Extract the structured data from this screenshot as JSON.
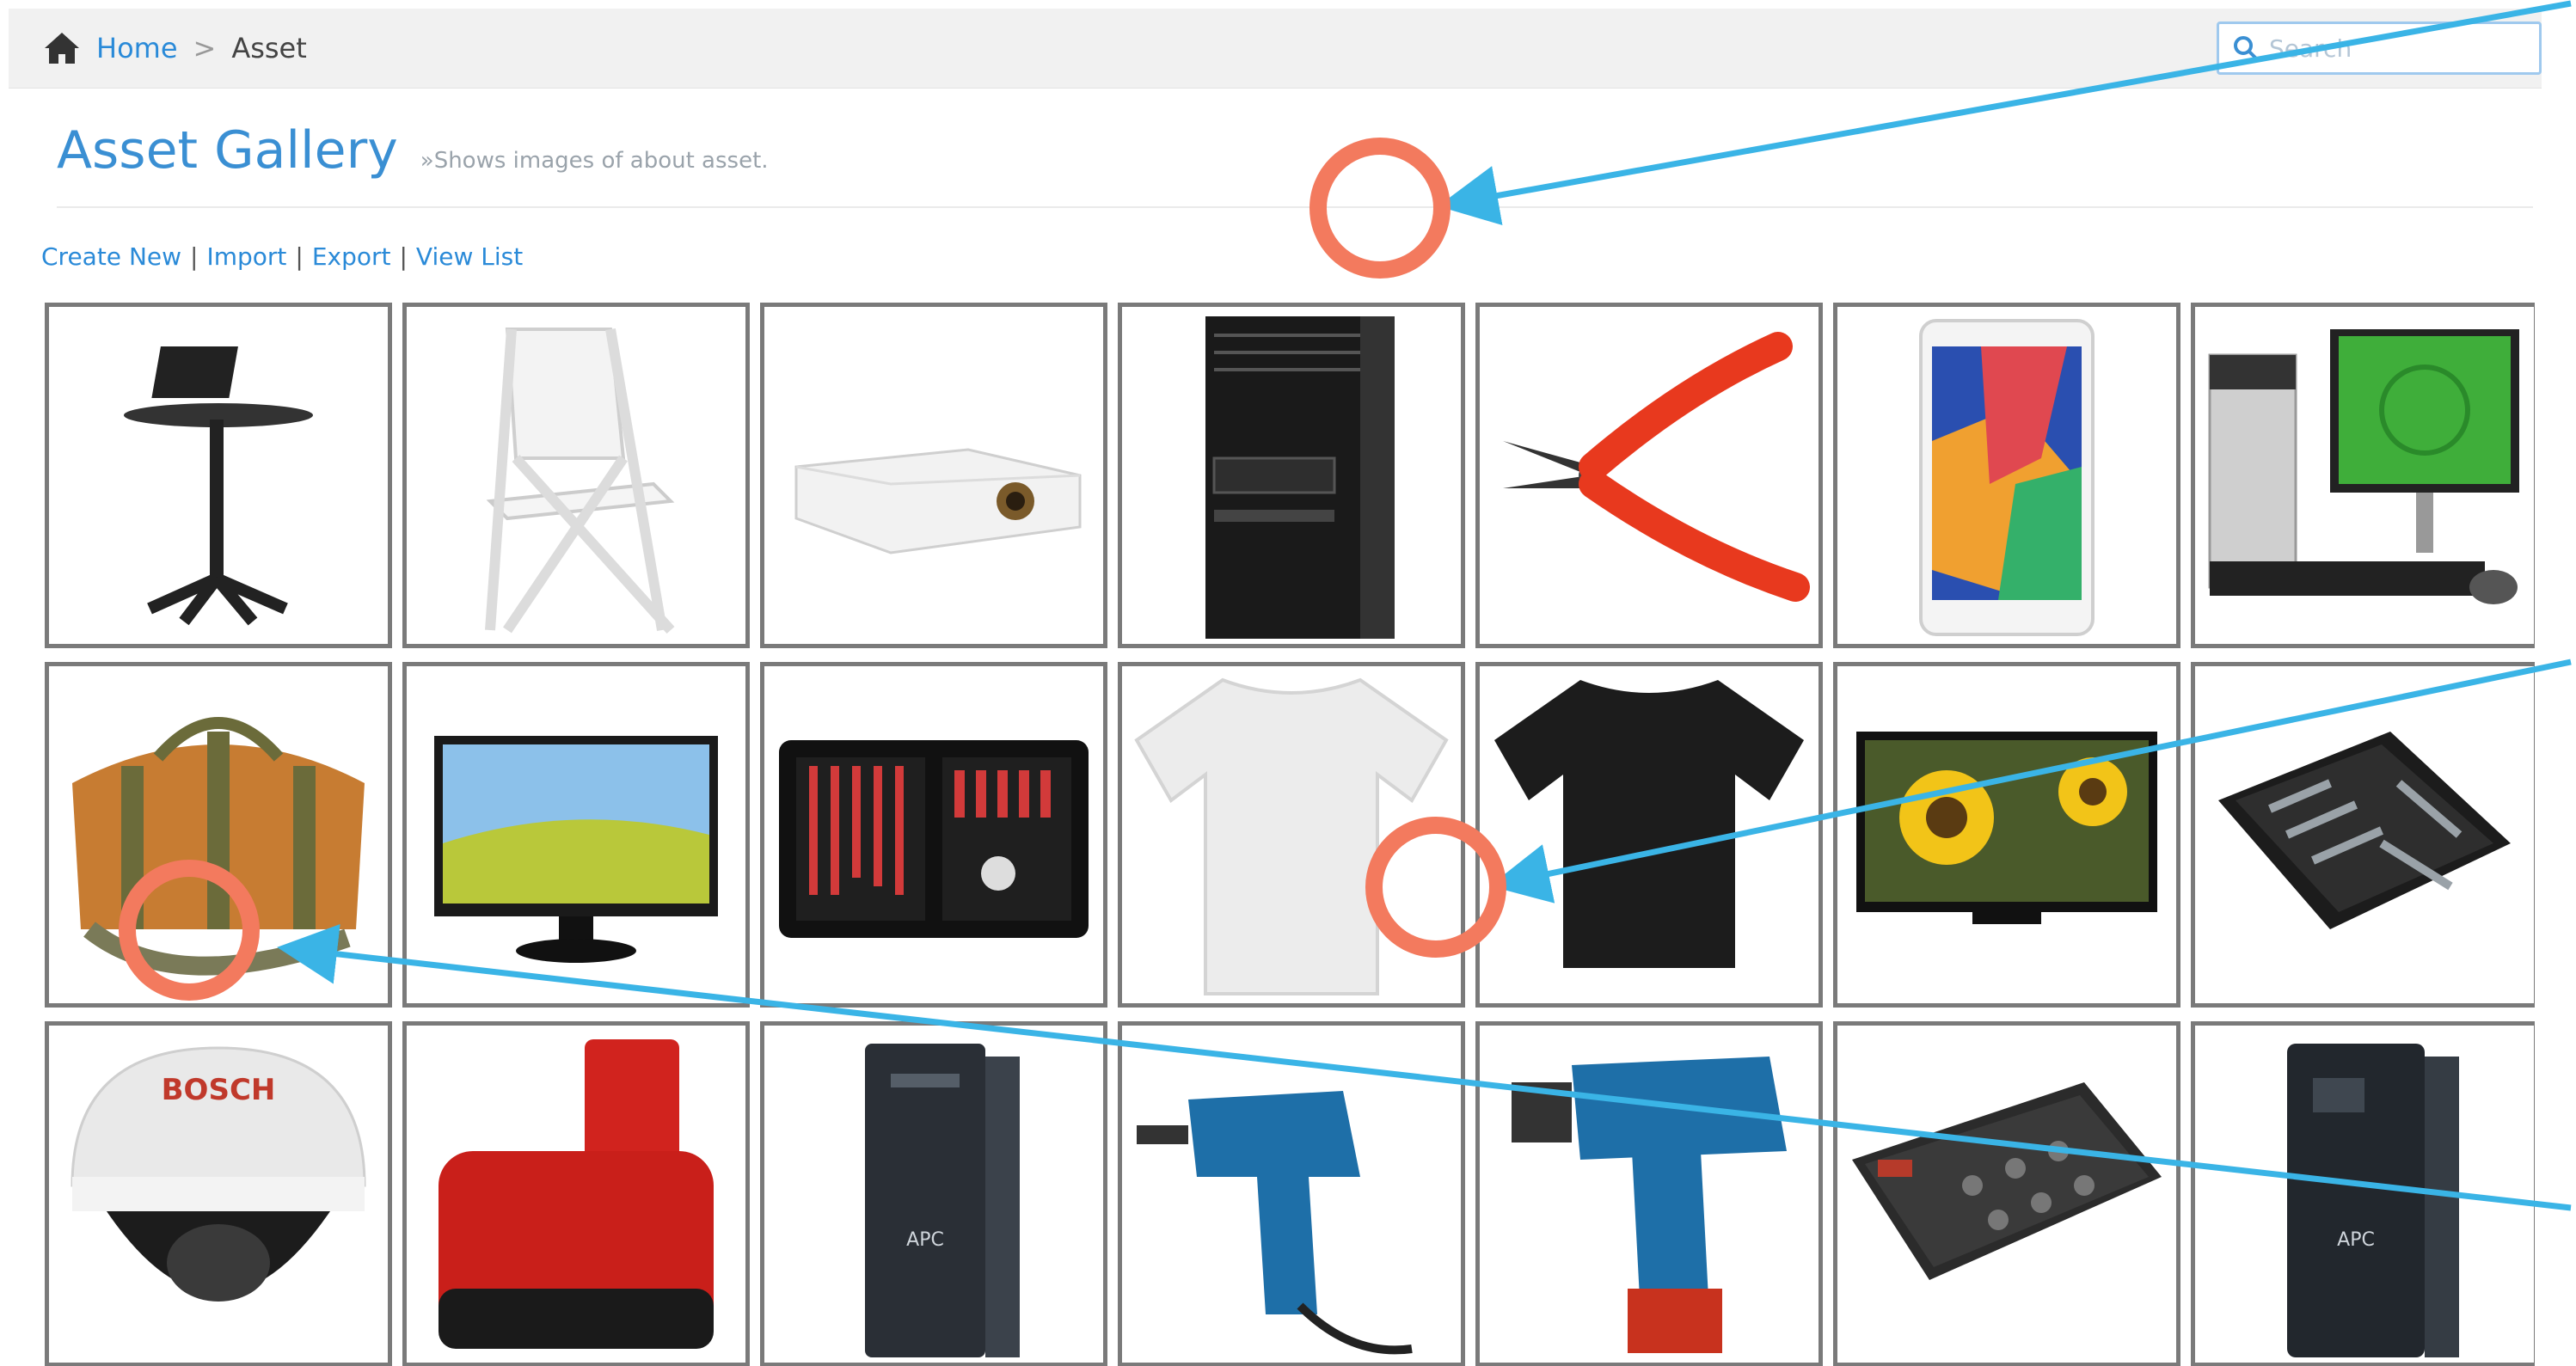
{
  "breadcrumb": {
    "home": "Home",
    "separator": ">",
    "current": "Asset"
  },
  "search": {
    "placeholder": "Search"
  },
  "header": {
    "title": "Asset Gallery",
    "subtitle": "»Shows images of about asset."
  },
  "actions": [
    {
      "label": "Create New"
    },
    {
      "label": "Import"
    },
    {
      "label": "Export"
    },
    {
      "label": "View List"
    }
  ],
  "action_separator": "|",
  "icons": [
    "home-icon",
    "search-icon"
  ],
  "colors": {
    "link": "#2a8ad8",
    "title": "#3a8fd3",
    "tile_border": "#7a7a7a",
    "annotation_circle": "#f37a5e",
    "annotation_arrow": "#3ab4e6"
  },
  "gallery": [
    {
      "item": "laptop-stand",
      "brand": ""
    },
    {
      "item": "folding-chair",
      "brand": ""
    },
    {
      "item": "projector",
      "brand": ""
    },
    {
      "item": "tower-server",
      "brand": ""
    },
    {
      "item": "wire-cutter",
      "brand": ""
    },
    {
      "item": "tablet",
      "brand": ""
    },
    {
      "item": "desktop-computer",
      "brand": ""
    },
    {
      "item": "tool-bag",
      "brand": ""
    },
    {
      "item": "monitor",
      "brand": ""
    },
    {
      "item": "tool-kit-case",
      "brand": ""
    },
    {
      "item": "white-tshirt",
      "brand": ""
    },
    {
      "item": "black-tshirt",
      "brand": ""
    },
    {
      "item": "television",
      "brand": ""
    },
    {
      "item": "tool-kit-zip",
      "brand": ""
    },
    {
      "item": "dome-camera",
      "brand": "BOSCH"
    },
    {
      "item": "battery-pack",
      "brand": ""
    },
    {
      "item": "ups",
      "brand": "APC"
    },
    {
      "item": "corded-drill",
      "brand": ""
    },
    {
      "item": "cordless-drill",
      "brand": ""
    },
    {
      "item": "power-strip",
      "brand": ""
    },
    {
      "item": "ups-large",
      "brand": "APC"
    }
  ]
}
